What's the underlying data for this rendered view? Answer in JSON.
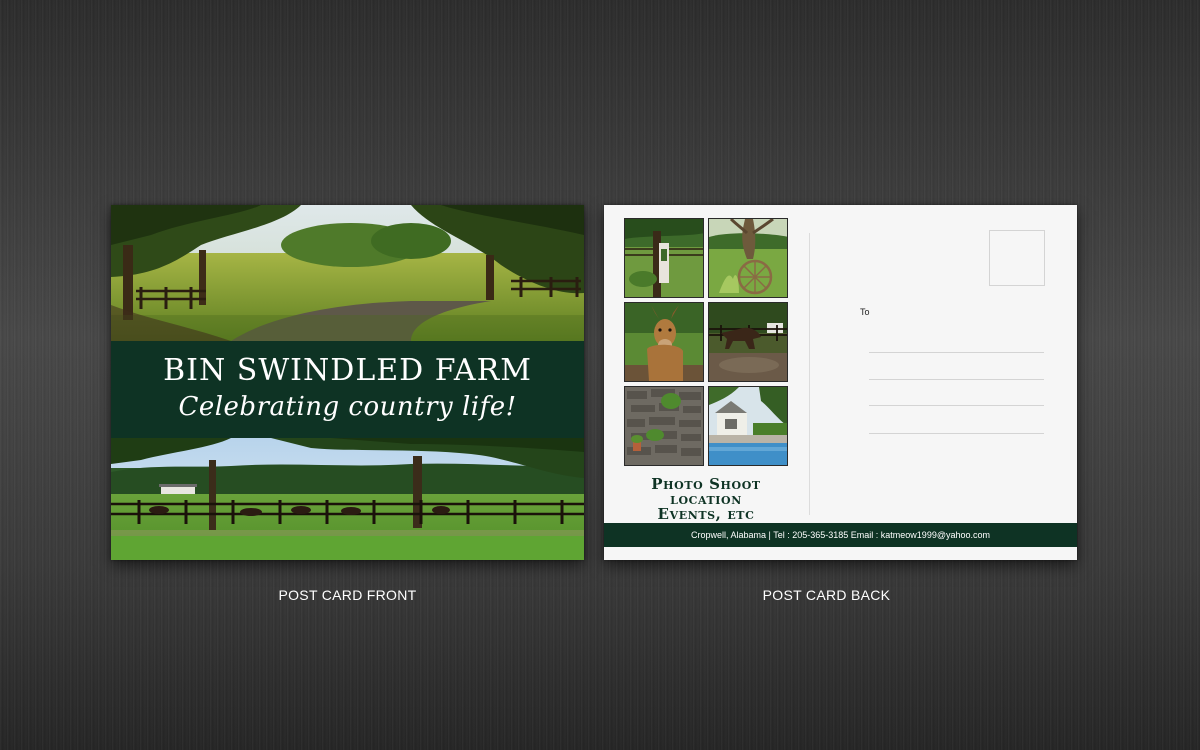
{
  "front": {
    "farm_name": "BIN SWINDLED FARM",
    "tagline": "Celebrating country life!",
    "caption": "POST CARD FRONT"
  },
  "back": {
    "heading_line1": "Photo Shoot location",
    "heading_line2": "Events, etc",
    "to_label": "To",
    "footer": "Cropwell, Alabama | Tel : 205-365-3185  Email : katmeow1999@yahoo.com",
    "caption": "POST CARD BACK"
  },
  "colors": {
    "brand_green": "#0e3324",
    "background": "#3c3c3c",
    "card_back": "#f6f6f6"
  }
}
